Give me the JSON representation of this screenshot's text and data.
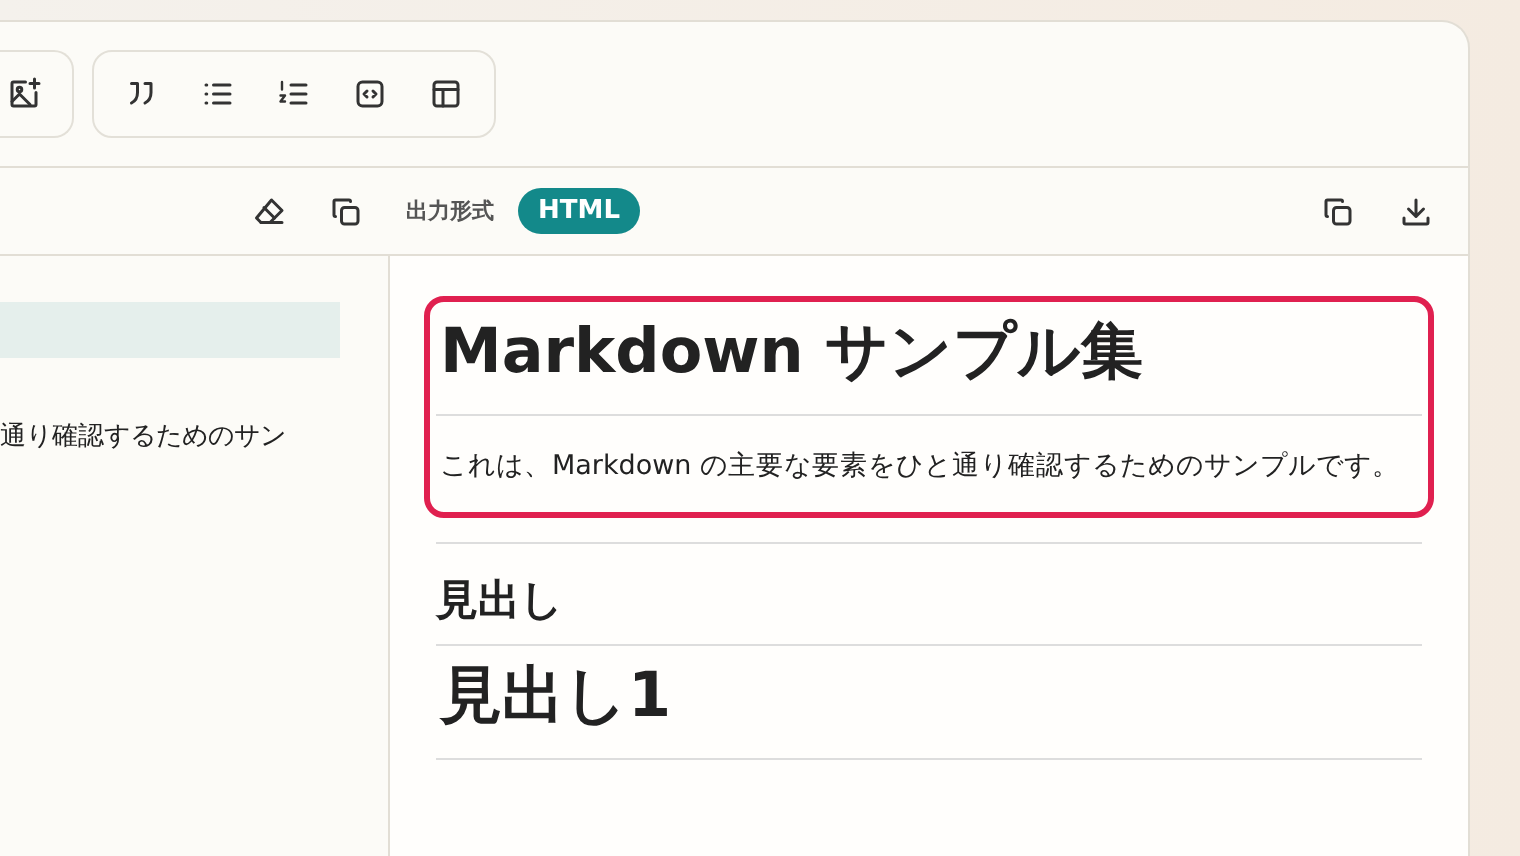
{
  "toolbar": {
    "groups": [
      {
        "buttons": [
          {
            "kind": "image"
          }
        ]
      },
      {
        "buttons": [
          {
            "kind": "quote"
          },
          {
            "kind": "bullet_list"
          },
          {
            "kind": "numbered_list"
          },
          {
            "kind": "code"
          },
          {
            "kind": "table"
          }
        ]
      }
    ]
  },
  "output_bar": {
    "actions": [
      {
        "kind": "erase"
      },
      {
        "kind": "copy"
      }
    ],
    "format_label": "出力形式",
    "format_badge": "HTML",
    "preview_actions": [
      {
        "kind": "copy"
      },
      {
        "kind": "download"
      }
    ]
  },
  "editor": {
    "lines": [
      "通り確認するためのサン"
    ]
  },
  "preview": {
    "highlighted_blocks": [
      {
        "kind": "h1",
        "text": "Markdown サンプル集"
      },
      {
        "kind": "p",
        "text": "これは、Markdown の主要な要素をひと通り確認するためのサンプルです。"
      }
    ],
    "blocks": [
      {
        "kind": "hr"
      },
      {
        "kind": "h2",
        "text": "見出し"
      },
      {
        "kind": "h1",
        "text": "見出し1"
      }
    ]
  }
}
